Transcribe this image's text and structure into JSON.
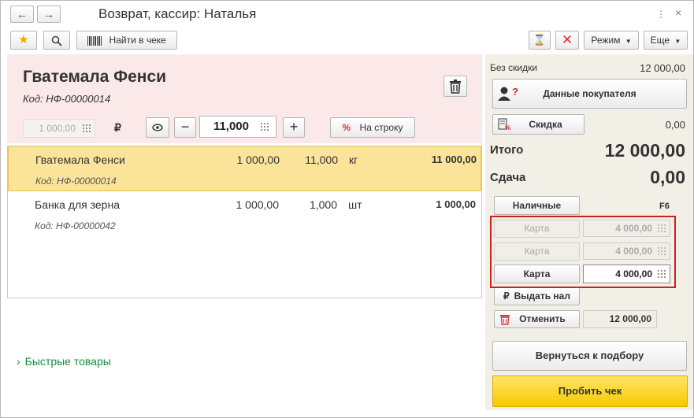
{
  "window": {
    "title": "Возврат, кассир: Наталья"
  },
  "toolbar": {
    "find_in_receipt": "Найти в чеке",
    "mode": "Режим",
    "more": "Еще"
  },
  "product": {
    "name": "Гватемала Фенси",
    "code": "Код: НФ-00000014",
    "price": "1 000,00",
    "currency": "₽",
    "quantity": "11,000",
    "to_line": "На строку"
  },
  "items": [
    {
      "name": "Гватемала Фенси",
      "code": "Код: НФ-00000014",
      "price": "1 000,00",
      "qty": "11,000",
      "unit": "кг",
      "sum": "11 000,00"
    },
    {
      "name": "Банка для зерна",
      "code": "Код: НФ-00000042",
      "price": "1 000,00",
      "qty": "1,000",
      "unit": "шт",
      "sum": "1 000,00"
    }
  ],
  "quick_goods": "Быстрые товары",
  "summary": {
    "no_discount_label": "Без скидки",
    "no_discount_value": "12 000,00",
    "customer_data": "Данные покупателя",
    "discount": "Скидка",
    "discount_value": "0,00",
    "total_label": "Итого",
    "total_value": "12 000,00",
    "change_label": "Сдача",
    "change_value": "0,00",
    "cash": "Наличные",
    "cash_hotkey": "F6",
    "cards": [
      {
        "label": "Карта",
        "amount": "4 000,00"
      },
      {
        "label": "Карта",
        "amount": "4 000,00"
      },
      {
        "label": "Карта",
        "amount": "4 000,00"
      }
    ],
    "give_cash": "Выдать нал",
    "cancel": "Отменить",
    "cancel_amount": "12 000,00",
    "back_to_selection": "Вернуться к подбору",
    "print_receipt": "Пробить чек"
  },
  "colors": {
    "selected_row": "#fbe49a",
    "pink_header": "#fbe9e9",
    "right_panel": "#f2f0e6",
    "highlight_border": "#d11f1f",
    "print_button": "#f7c900",
    "quick_link": "#1b8a3c"
  }
}
